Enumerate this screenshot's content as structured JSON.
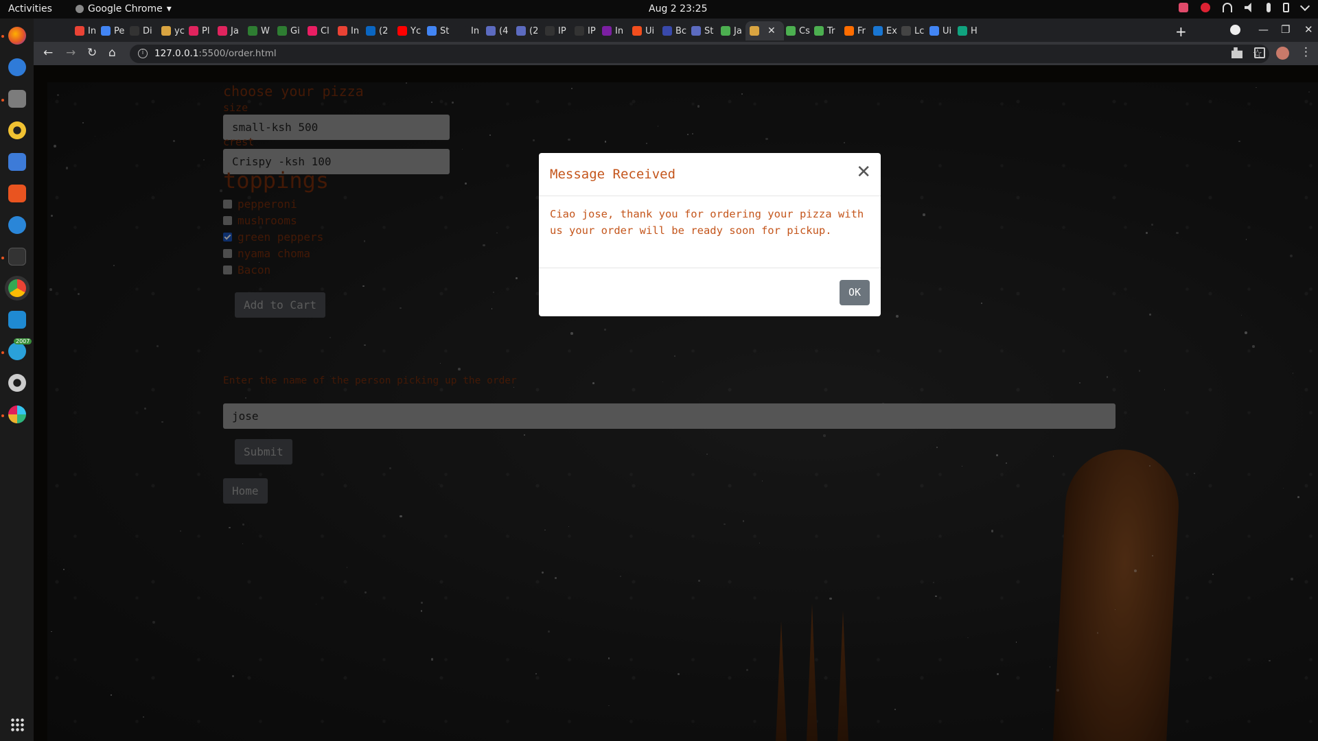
{
  "topbar": {
    "activities": "Activities",
    "app_name": "Google Chrome",
    "clock": "Aug 2  23:25"
  },
  "dock": {
    "badge_count": "2007"
  },
  "tabs": [
    {
      "label": "In",
      "color": "#ea4335"
    },
    {
      "label": "Pe",
      "color": "#4285f4"
    },
    {
      "label": "Di",
      "color": "#333333"
    },
    {
      "label": "yc",
      "color": "#d9a441"
    },
    {
      "label": "Pl",
      "color": "#e0245e"
    },
    {
      "label": "Ja",
      "color": "#e0245e"
    },
    {
      "label": "W",
      "color": "#2e7d32"
    },
    {
      "label": "Gi",
      "color": "#2e7d32"
    },
    {
      "label": "Cl",
      "color": "#e91e63"
    },
    {
      "label": "In",
      "color": "#ea4335"
    },
    {
      "label": "(2",
      "color": "#0a66c2"
    },
    {
      "label": "Yc",
      "color": "#ff0000"
    },
    {
      "label": "St",
      "color": "#4285f4"
    },
    {
      "label": "In",
      "color": "#202124"
    },
    {
      "label": "(4",
      "color": "#5c6bc0"
    },
    {
      "label": "(2",
      "color": "#5c6bc0"
    },
    {
      "label": "IP",
      "color": "#333333"
    },
    {
      "label": "IP",
      "color": "#333333"
    },
    {
      "label": "In",
      "color": "#7b1fa2"
    },
    {
      "label": "Ui",
      "color": "#f24e1e"
    },
    {
      "label": "Bc",
      "color": "#3949ab"
    },
    {
      "label": "St",
      "color": "#5c6bc0"
    },
    {
      "label": "Ja",
      "color": "#4caf50"
    },
    {
      "label": "",
      "color": "#d9a441",
      "active": true
    },
    {
      "label": "Cs",
      "color": "#4caf50"
    },
    {
      "label": "Tr",
      "color": "#4caf50"
    },
    {
      "label": "Fr",
      "color": "#ff6d00"
    },
    {
      "label": "Ex",
      "color": "#1976d2"
    },
    {
      "label": "Lc",
      "color": "#444444"
    },
    {
      "label": "Ui",
      "color": "#4285f4"
    },
    {
      "label": "H",
      "color": "#10a37f"
    }
  ],
  "toolbar": {
    "url_host": "127.0.0.1",
    "url_path": ":5500/order.html"
  },
  "page": {
    "heading": "choose your pizza",
    "size_label": "size",
    "size_value": "small-ksh 500",
    "crust_label": "crest",
    "crust_value": "Crispy -ksh 100",
    "toppings_heading": "toppings",
    "toppings": [
      {
        "label": "pepperoni",
        "checked": false
      },
      {
        "label": "mushrooms",
        "checked": false
      },
      {
        "label": "green peppers",
        "checked": true
      },
      {
        "label": "nyama choma",
        "checked": false
      },
      {
        "label": "Bacon",
        "checked": false
      }
    ],
    "add_to_cart": "Add to Cart",
    "name_label": "Enter the name of the person picking up the order",
    "name_value": "jose",
    "submit": "Submit",
    "home": "Home"
  },
  "modal": {
    "title": "Message Received",
    "close_glyph": "✕",
    "body": "Ciao jose, thank you for ordering your pizza with us your order will be ready soon for pickup.",
    "ok": "OK"
  },
  "colors": {
    "text_accent": "#c4551b",
    "page_text": "#7a2e0c",
    "ok_button": "#6c757d"
  }
}
